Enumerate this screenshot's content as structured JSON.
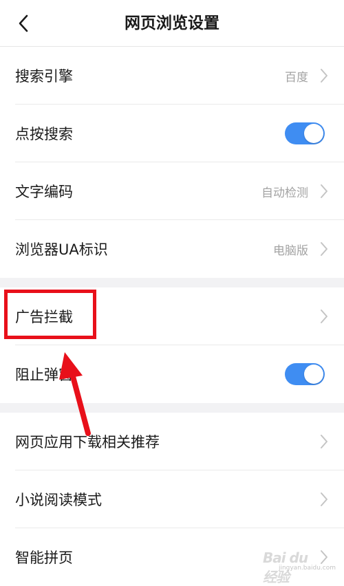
{
  "header": {
    "title": "网页浏览设置",
    "back_icon": "chevron-left-icon"
  },
  "groups": [
    {
      "items": [
        {
          "label": "搜索引擎",
          "value": "百度",
          "control": "chevron"
        },
        {
          "label": "点按搜索",
          "value": "",
          "control": "toggle",
          "on": true
        },
        {
          "label": "文字编码",
          "value": "自动检测",
          "control": "chevron"
        },
        {
          "label": "浏览器UA标识",
          "value": "电脑版",
          "control": "chevron"
        }
      ]
    },
    {
      "items": [
        {
          "label": "广告拦截",
          "value": "",
          "control": "chevron"
        },
        {
          "label": "阻止弹窗",
          "value": "",
          "control": "toggle",
          "on": true
        }
      ]
    },
    {
      "items": [
        {
          "label": "网页应用下载相关推荐",
          "value": "",
          "control": "chevron"
        },
        {
          "label": "小说阅读模式",
          "value": "",
          "control": "chevron"
        },
        {
          "label": "智能拼页",
          "value": "",
          "control": "chevron"
        }
      ]
    }
  ],
  "colors": {
    "toggle_on": "#3f8df2",
    "annotation": "#e8101a",
    "section_gap": "#f2f2f4"
  },
  "watermark": {
    "logo": "Bai du 经验",
    "url": "jingyan.baidu.com"
  }
}
